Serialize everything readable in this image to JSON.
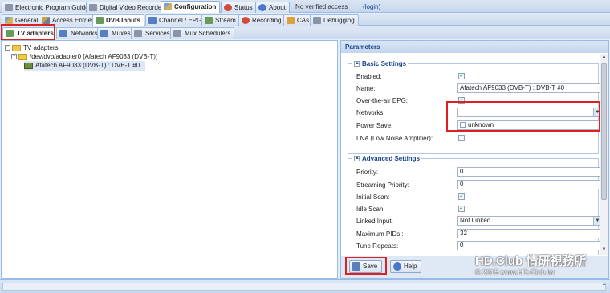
{
  "top_tabs": [
    {
      "label": "Electronic Program Guide"
    },
    {
      "label": "Digital Video Recorder"
    },
    {
      "label": "Configuration"
    },
    {
      "label": "Status"
    },
    {
      "label": "About"
    }
  ],
  "auth_status": "No verified access",
  "login_link": "(login)",
  "config_tabs": [
    {
      "label": "General"
    },
    {
      "label": "Access Entries"
    },
    {
      "label": "DVB Inputs"
    },
    {
      "label": "Channel / EPG"
    },
    {
      "label": "Stream"
    },
    {
      "label": "Recording"
    },
    {
      "label": "CAs"
    },
    {
      "label": "Debugging"
    }
  ],
  "dvb_tabs": [
    {
      "label": "TV adapters"
    },
    {
      "label": "Networks"
    },
    {
      "label": "Muxes"
    },
    {
      "label": "Services"
    },
    {
      "label": "Mux Schedulers"
    }
  ],
  "tree": {
    "root": "TV adapters",
    "adapter": "/dev/dvb/adapter0 [Afatech AF9033 (DVB-T)]",
    "frontend": "Afatech AF9033 (DVB-T) : DVB-T #0"
  },
  "parameters": {
    "title": "Parameters",
    "basic_legend": "Basic Settings",
    "enabled_label": "Enabled:",
    "name_label": "Name:",
    "name_value": "Afatech AF9033 (DVB-T) : DVB-T #0",
    "ota_epg_label": "Over-the-air EPG:",
    "networks_label": "Networks:",
    "networks_value": "",
    "networks_option": "unknown",
    "power_save_label": "Power Save:",
    "lna_label": "LNA (Low Noise Amplifier):",
    "advanced_legend": "Advanced Settings",
    "priority_label": "Priority:",
    "priority_value": "0",
    "streaming_priority_label": "Streaming Priority:",
    "streaming_priority_value": "0",
    "initial_scan_label": "Initial Scan:",
    "idle_scan_label": "Idle Scan:",
    "linked_input_label": "Linked Input:",
    "linked_input_value": "Not Linked",
    "max_pids_label": "Maximum PIDs :",
    "max_pids_value": "32",
    "tune_repeats_label": "Tune Repeats:",
    "tune_repeats_value": "0"
  },
  "buttons": {
    "save": "Save",
    "help": "Help"
  },
  "watermark": {
    "line1": "HD.Club 情研視務所",
    "line2": "© 2015  www.HD.Club.tw"
  },
  "colors": {
    "highlight_box": "#e02020",
    "panel_border": "#99bbe8",
    "header_text": "#15428b"
  }
}
